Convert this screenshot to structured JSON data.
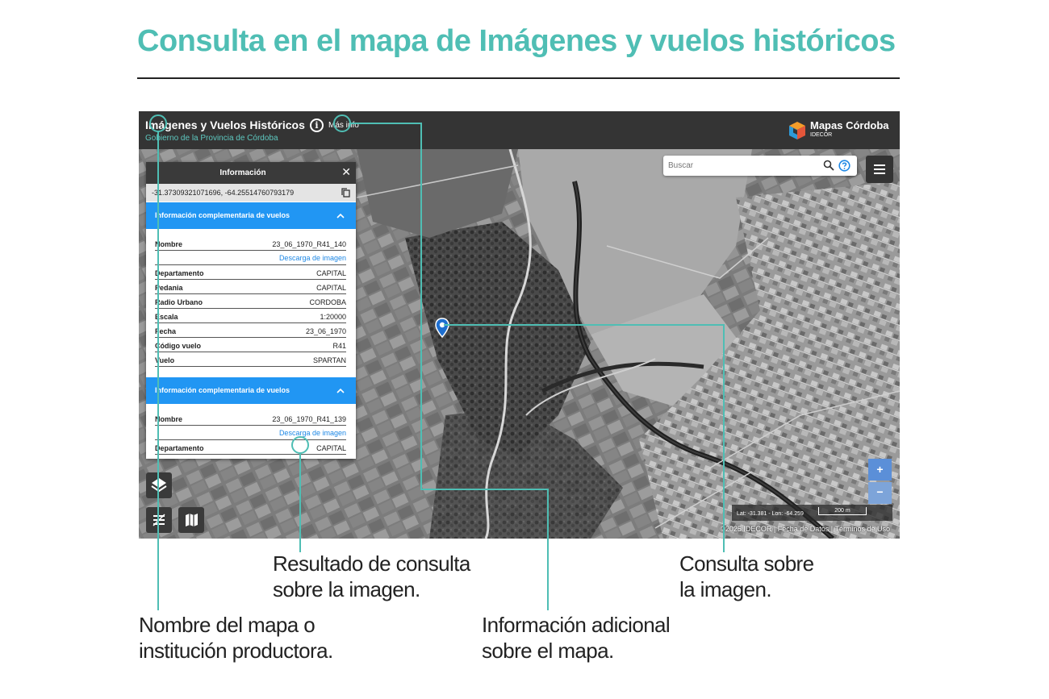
{
  "headline": "Consulta en el mapa de Imágenes y vuelos históricos",
  "colors": {
    "accent": "#4fbeb4",
    "panel_header": "#2196f3",
    "topbar": "#343434"
  },
  "app": {
    "title": "Imágenes y Vuelos Históricos",
    "subtitle": "Gobierno de la Provincia de Córdoba",
    "info_icon": "info-circle-icon",
    "more_info_label": "Más info",
    "brand": {
      "name": "Mapas Córdoba",
      "sub": "IDECOR"
    }
  },
  "search": {
    "placeholder": "Buscar"
  },
  "info_panel": {
    "title": "Información",
    "coordinates": "-31.37309321071696, -64.25514760793179",
    "sections": [
      {
        "title": "Información complementaria de vuelos",
        "nombre_label": "Nombre",
        "nombre": "23_06_1970_R41_140",
        "download": "Descarga de imagen",
        "rows": [
          {
            "k": "Departamento",
            "v": "CAPITAL"
          },
          {
            "k": "Pedania",
            "v": "CAPITAL"
          },
          {
            "k": "Radio Urbano",
            "v": "CORDOBA"
          },
          {
            "k": "Escala",
            "v": "1:20000"
          },
          {
            "k": "Fecha",
            "v": "23_06_1970"
          },
          {
            "k": "Código vuelo",
            "v": "R41"
          },
          {
            "k": "Vuelo",
            "v": "SPARTAN"
          }
        ]
      },
      {
        "title": "Información complementaria de vuelos",
        "nombre_label": "Nombre",
        "nombre": "23_06_1970_R41_139",
        "download": "Descarga de imagen",
        "rows": [
          {
            "k": "Departamento",
            "v": "CAPITAL"
          }
        ]
      }
    ]
  },
  "map_controls": {
    "zoom_in": "+",
    "zoom_out": "−",
    "coords": "Lat: -31.381 - Lon: -64.259",
    "scale": "200 m",
    "attribution": "©2025 IDECOR | Fecha de Datos | Términos de Uso"
  },
  "captions": {
    "resultado": [
      "Resultado de consulta",
      "sobre la imagen."
    ],
    "consulta": [
      "Consulta sobre",
      "la imagen."
    ],
    "nombre": [
      "Nombre del mapa o",
      "institución productora."
    ],
    "informacion": [
      "Información adicional",
      "sobre el mapa."
    ]
  }
}
